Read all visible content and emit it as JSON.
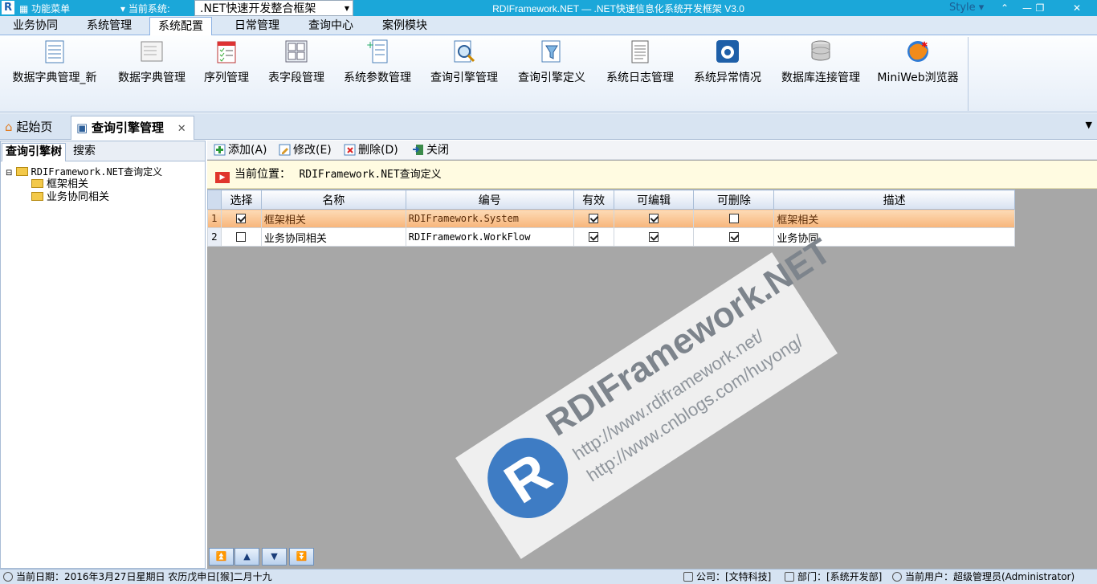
{
  "titlebar": {
    "menu_button": "功能菜单",
    "current_system_label": "当前系统:",
    "current_system_value": ".NET快速开发整合框架",
    "window_title": "RDIFramework.NET — .NET快速信息化系统开发框架 V3.0",
    "style_label": "Style",
    "min": "—",
    "restore": "❐",
    "close": "✕"
  },
  "ribbon_tabs": [
    "业务协同",
    "系统管理",
    "系统配置",
    "日常管理",
    "查询中心",
    "案例模块"
  ],
  "ribbon_active_tab": "系统配置",
  "ribbon_buttons": [
    {
      "label": "数据字典管理_新",
      "icon": "list-table-icon"
    },
    {
      "label": "数据字典管理",
      "icon": "dictionary-icon"
    },
    {
      "label": "序列管理",
      "icon": "checklist-icon"
    },
    {
      "label": "表字段管理",
      "icon": "table-fields-icon"
    },
    {
      "label": "系统参数管理",
      "icon": "parameters-icon"
    },
    {
      "label": "查询引擎管理",
      "icon": "query-engine-icon"
    },
    {
      "label": "查询引擎定义",
      "icon": "filter-icon"
    },
    {
      "label": "系统日志管理",
      "icon": "log-icon"
    },
    {
      "label": "系统异常情况",
      "icon": "exception-icon"
    },
    {
      "label": "数据库连接管理",
      "icon": "database-icon"
    },
    {
      "label": "MiniWeb浏览器",
      "icon": "browser-icon"
    }
  ],
  "doc_tabs": [
    {
      "label": "起始页",
      "icon": "home-icon"
    },
    {
      "label": "查询引擎管理",
      "icon": "query-engine-icon",
      "closable": true
    }
  ],
  "left_panel": {
    "tabs": [
      "查询引擎树",
      "搜索"
    ],
    "tree_root": "RDIFramework.NET查询定义",
    "tree_children": [
      "框架相关",
      "业务协同相关"
    ]
  },
  "toolbar": {
    "add": "添加(A)",
    "edit": "修改(E)",
    "delete": "删除(D)",
    "close": "关闭"
  },
  "location": {
    "label": "当前位置：",
    "value": "RDIFramework.NET查询定义"
  },
  "grid": {
    "columns": [
      "选择",
      "名称",
      "编号",
      "有效",
      "可编辑",
      "可删除",
      "描述"
    ],
    "rows": [
      {
        "rownum": "1",
        "selected": true,
        "name": "框架相关",
        "code": "RDIFramework.System",
        "valid": true,
        "editable": true,
        "deletable": false,
        "desc": "框架相关"
      },
      {
        "rownum": "2",
        "selected": false,
        "name": "业务协同相关",
        "code": "RDIFramework.WorkFlow",
        "valid": true,
        "editable": true,
        "deletable": true,
        "desc": "业务协同"
      }
    ]
  },
  "nav_buttons": [
    "first",
    "previous",
    "next",
    "last"
  ],
  "watermark": {
    "line1": "RDIFramework.NET",
    "line2": "http://www.rdiframework.net/",
    "line3": "http://www.cnblogs.com/huyong/"
  },
  "statusbar": {
    "date": "当前日期：2016年3月27日星期日 农历戊申日[猴]二月十九",
    "company": "公司：[文特科技]",
    "department": "部门：[系统开发部]",
    "user": "当前用户：超级管理员(Administrator)"
  },
  "colors": {
    "titlebar": "#1ba7d9",
    "selected_row": "#f7b47a",
    "grid_background": "#a7a7a7",
    "location_bar": "#fffbe1"
  }
}
